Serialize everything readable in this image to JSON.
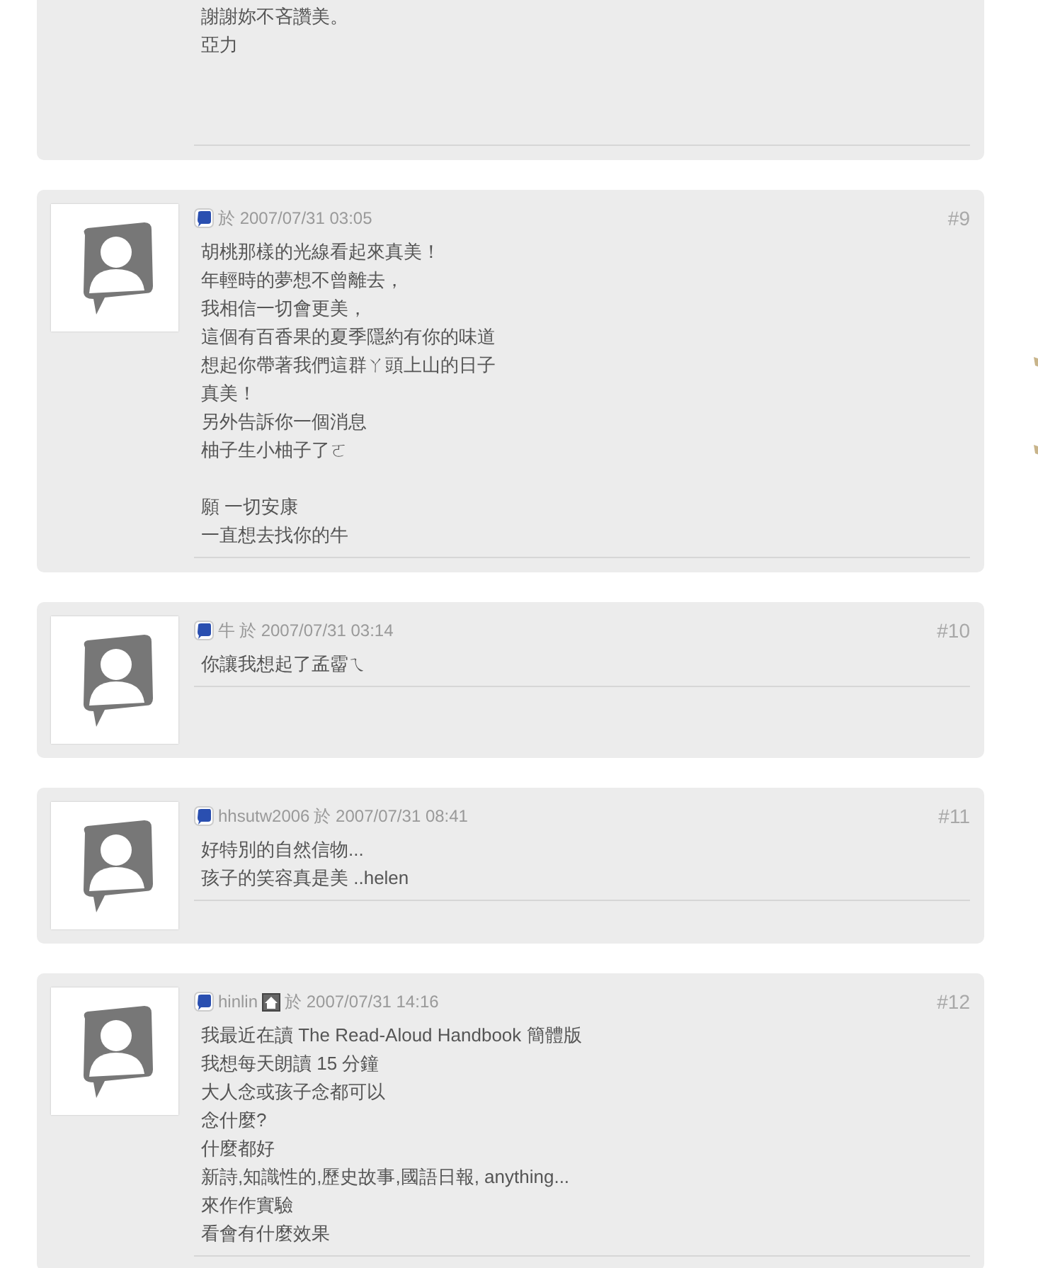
{
  "posts": [
    {
      "paragraphs": [
        [
          "謝謝妳不吝讚美。",
          "亞力"
        ]
      ]
    },
    {
      "number": "#9",
      "posted": "於 2007/07/31 03:05",
      "homepage": false,
      "paragraphs": [
        [
          "胡桃那樣的光線看起來真美！",
          "年輕時的夢想不曾離去，",
          "我相信一切會更美，",
          "這個有百香果的夏季隱約有你的味道",
          "想起你帶著我們這群ㄚ頭上山的日子",
          "真美！",
          "另外告訴你一個消息",
          "柚子生小柚子了ㄛ"
        ],
        [
          "願 一切安康",
          "一直想去找你的牛"
        ]
      ]
    },
    {
      "number": "#10",
      "author": "牛",
      "posted": "於 2007/07/31 03:14",
      "homepage": false,
      "paragraphs": [
        [
          "你讓我想起了孟霤ㄟ"
        ]
      ]
    },
    {
      "number": "#11",
      "author": "hhsutw2006",
      "posted": "於 2007/07/31 08:41",
      "homepage": false,
      "paragraphs": [
        [
          "好特別的自然信物...",
          "孩子的笑容真是美 ..helen"
        ]
      ]
    },
    {
      "number": "#12",
      "author": "hinlin",
      "posted": "於 2007/07/31 14:16",
      "homepage": true,
      "paragraphs": [
        [
          "我最近在讀 The Read-Aloud Handbook 簡體版",
          "我想每天朗讀 15 分鐘",
          "大人念或孩子念都可以",
          "念什麼?",
          "什麼都好",
          "新詩,知識性的,歷史故事,國語日報, anything...",
          "來作作實驗",
          "看會有什麼效果"
        ]
      ]
    }
  ]
}
